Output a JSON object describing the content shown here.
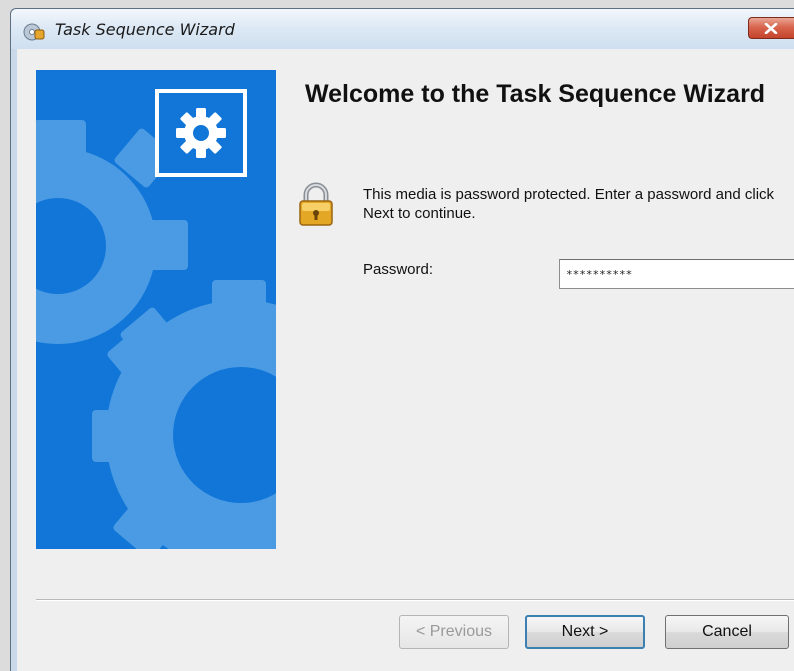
{
  "window": {
    "title": "Task Sequence Wizard",
    "close_icon": "close-icon"
  },
  "banner": {
    "logo_icon": "gear-icon",
    "background_color": "#1176d7"
  },
  "main": {
    "heading": "Welcome to the Task Sequence Wizard",
    "message": "This media is password protected.  Enter a password and click Next to continue.",
    "lock_icon": "padlock-icon",
    "password": {
      "label": "Password:",
      "value": "**********"
    }
  },
  "buttons": {
    "previous": "< Previous",
    "next": "Next >",
    "cancel": "Cancel"
  }
}
